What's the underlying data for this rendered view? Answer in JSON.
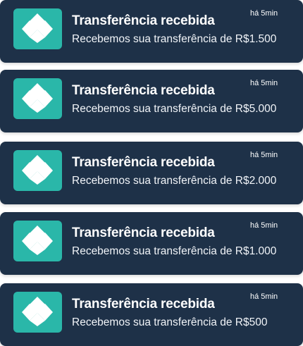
{
  "notifications": [
    {
      "app_icon": "pix-logo-icon",
      "title": "Transferência recebida",
      "body": "Recebemos sua transferência de R$1.500",
      "time": "há 5min"
    },
    {
      "app_icon": "pix-logo-icon",
      "title": "Transferência recebida",
      "body": "Recebemos sua transferência de R$5.000",
      "time": "há 5min"
    },
    {
      "app_icon": "pix-logo-icon",
      "title": "Transferência recebida",
      "body": "Recebemos sua transferência de R$2.000",
      "time": "há 5min"
    },
    {
      "app_icon": "pix-logo-icon",
      "title": "Transferência recebida",
      "body": "Recebemos sua transferência de R$1.000",
      "time": "há 5min"
    },
    {
      "app_icon": "pix-logo-icon",
      "title": "Transferência recebida",
      "body": "Recebemos sua transferência de R$500",
      "time": "há 5min"
    }
  ],
  "colors": {
    "card_background": "#1e3148",
    "icon_background": "#2ab7a9",
    "text": "#ffffff"
  }
}
